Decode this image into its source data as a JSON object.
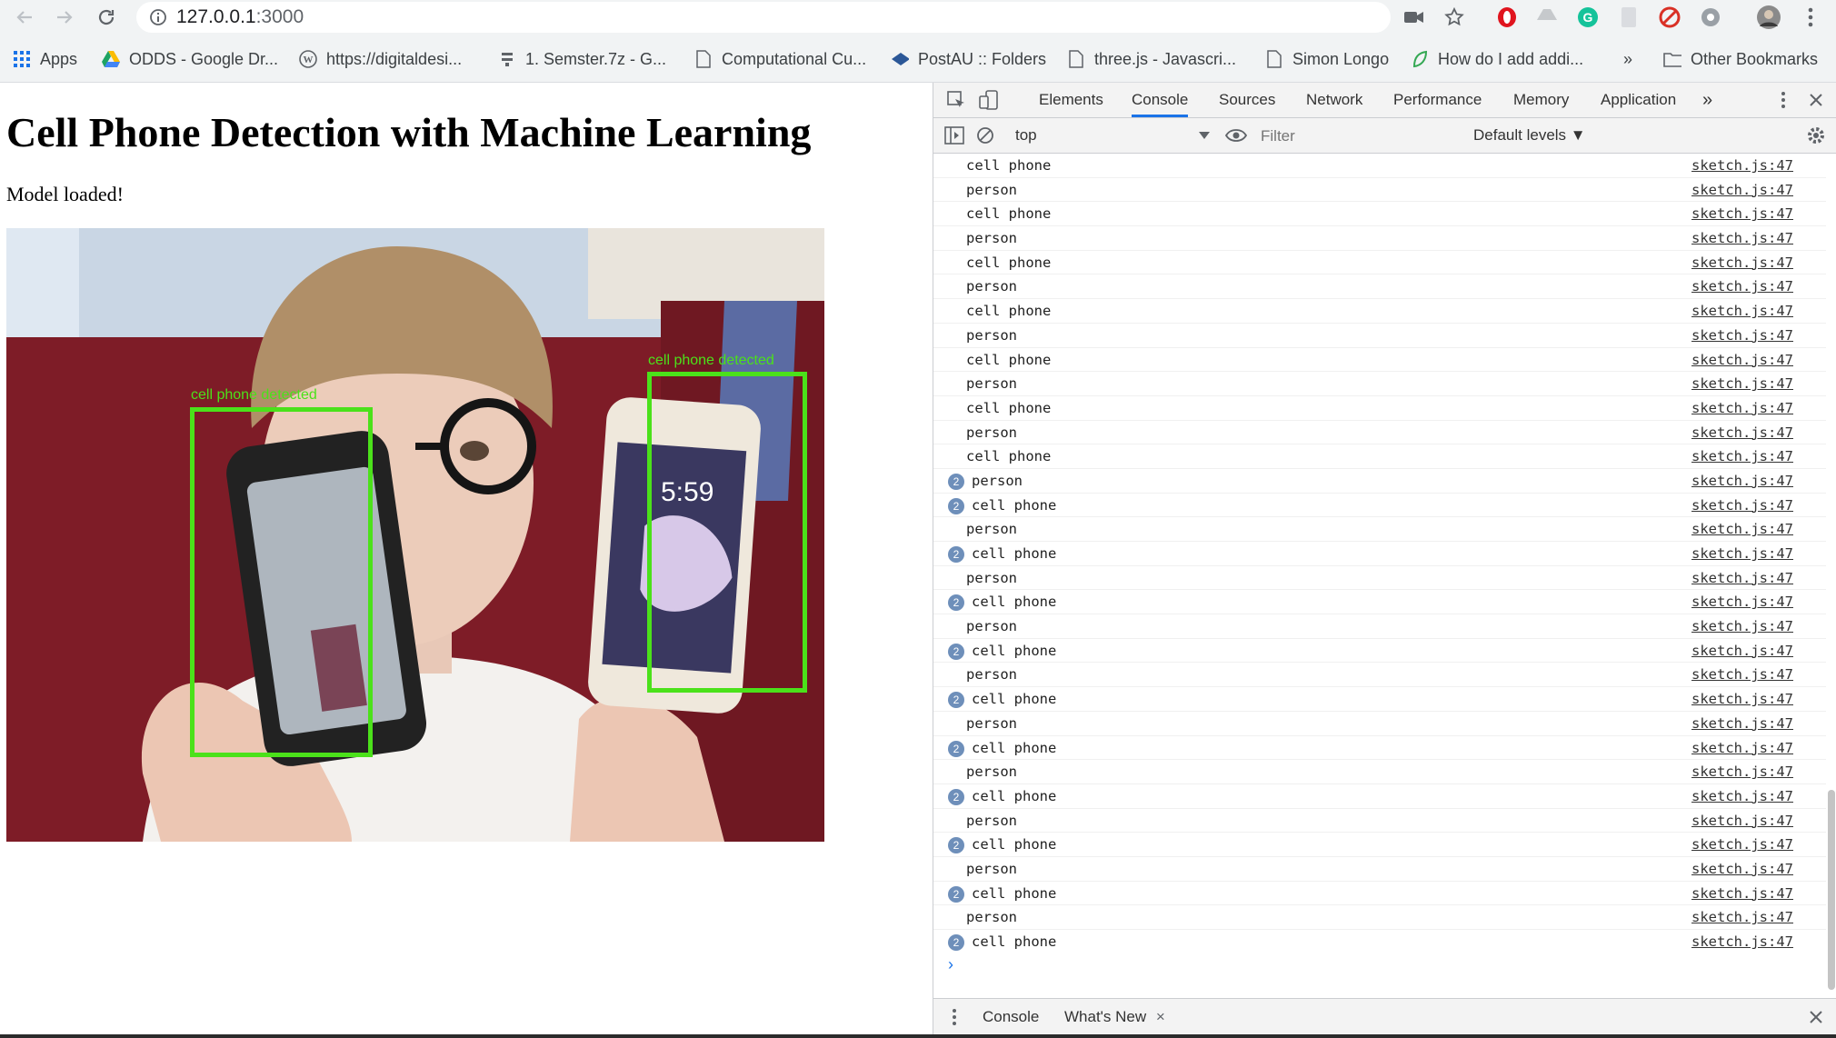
{
  "browser": {
    "url_host": "127.0.0.1",
    "url_port": ":3000",
    "bookmarks": [
      {
        "label": "Apps",
        "icon": "apps-grid-icon"
      },
      {
        "label": "ODDS - Google Dr...",
        "icon": "google-drive-icon"
      },
      {
        "label": "https://digitaldesi...",
        "icon": "wordpress-icon"
      },
      {
        "label": "1. Semster.7z - G...",
        "icon": "archive-icon"
      },
      {
        "label": "Computational Cu...",
        "icon": "page-icon"
      },
      {
        "label": "PostAU :: Folders",
        "icon": "postau-icon"
      },
      {
        "label": "three.js - Javascri...",
        "icon": "page-icon"
      },
      {
        "label": "Simon Longo",
        "icon": "page-icon"
      },
      {
        "label": "How do I add addi...",
        "icon": "leaf-icon"
      }
    ],
    "more_label": "»",
    "other_bookmarks": "Other Bookmarks"
  },
  "page": {
    "title": "Cell Phone Detection with Machine Learning",
    "status": "Model loaded!",
    "detections": [
      {
        "label": "cell phone detected"
      },
      {
        "label": "cell phone detected"
      }
    ]
  },
  "devtools": {
    "tabs": [
      "Elements",
      "Console",
      "Sources",
      "Network",
      "Performance",
      "Memory",
      "Application"
    ],
    "active_tab": "Console",
    "overflow": "»",
    "context": "top",
    "filter_placeholder": "Filter",
    "levels": "Default levels ▼",
    "log": [
      {
        "msg": "cell phone",
        "src": "sketch.js:47",
        "count": ""
      },
      {
        "msg": "person",
        "src": "sketch.js:47",
        "count": ""
      },
      {
        "msg": "cell phone",
        "src": "sketch.js:47",
        "count": ""
      },
      {
        "msg": "person",
        "src": "sketch.js:47",
        "count": ""
      },
      {
        "msg": "cell phone",
        "src": "sketch.js:47",
        "count": ""
      },
      {
        "msg": "person",
        "src": "sketch.js:47",
        "count": ""
      },
      {
        "msg": "cell phone",
        "src": "sketch.js:47",
        "count": ""
      },
      {
        "msg": "person",
        "src": "sketch.js:47",
        "count": ""
      },
      {
        "msg": "cell phone",
        "src": "sketch.js:47",
        "count": ""
      },
      {
        "msg": "person",
        "src": "sketch.js:47",
        "count": ""
      },
      {
        "msg": "cell phone",
        "src": "sketch.js:47",
        "count": ""
      },
      {
        "msg": "person",
        "src": "sketch.js:47",
        "count": ""
      },
      {
        "msg": "cell phone",
        "src": "sketch.js:47",
        "count": ""
      },
      {
        "msg": "person",
        "src": "sketch.js:47",
        "count": "2"
      },
      {
        "msg": "cell phone",
        "src": "sketch.js:47",
        "count": "2"
      },
      {
        "msg": "person",
        "src": "sketch.js:47",
        "count": ""
      },
      {
        "msg": "cell phone",
        "src": "sketch.js:47",
        "count": "2"
      },
      {
        "msg": "person",
        "src": "sketch.js:47",
        "count": ""
      },
      {
        "msg": "cell phone",
        "src": "sketch.js:47",
        "count": "2"
      },
      {
        "msg": "person",
        "src": "sketch.js:47",
        "count": ""
      },
      {
        "msg": "cell phone",
        "src": "sketch.js:47",
        "count": "2"
      },
      {
        "msg": "person",
        "src": "sketch.js:47",
        "count": ""
      },
      {
        "msg": "cell phone",
        "src": "sketch.js:47",
        "count": "2"
      },
      {
        "msg": "person",
        "src": "sketch.js:47",
        "count": ""
      },
      {
        "msg": "cell phone",
        "src": "sketch.js:47",
        "count": "2"
      },
      {
        "msg": "person",
        "src": "sketch.js:47",
        "count": ""
      },
      {
        "msg": "cell phone",
        "src": "sketch.js:47",
        "count": "2"
      },
      {
        "msg": "person",
        "src": "sketch.js:47",
        "count": ""
      },
      {
        "msg": "cell phone",
        "src": "sketch.js:47",
        "count": "2"
      },
      {
        "msg": "person",
        "src": "sketch.js:47",
        "count": ""
      },
      {
        "msg": "cell phone",
        "src": "sketch.js:47",
        "count": "2"
      },
      {
        "msg": "person",
        "src": "sketch.js:47",
        "count": ""
      },
      {
        "msg": "cell phone",
        "src": "sketch.js:47",
        "count": "2"
      }
    ],
    "drawer_tabs": [
      "Console",
      "What's New"
    ]
  },
  "colors": {
    "detection_box": "#4be11a",
    "active_tab_underline": "#1a73e8",
    "badge": "#6e8fba"
  }
}
